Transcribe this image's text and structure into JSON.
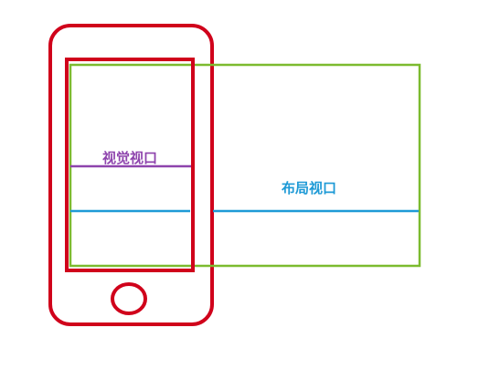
{
  "labels": {
    "visual_viewport": "视觉视口",
    "layout_viewport": "布局视口"
  },
  "colors": {
    "phone": "#d0021b",
    "visual_viewport": "#d0021b",
    "layout_viewport": "#7cbb2f",
    "visual_line": "#8e44ad",
    "layout_line": "#1e9ad6",
    "visual_label": "#8e44ad",
    "layout_label": "#1e9ad6"
  }
}
